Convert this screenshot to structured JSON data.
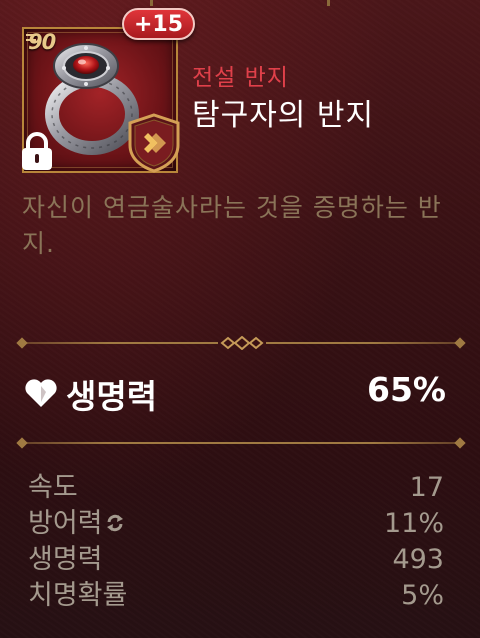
{
  "item": {
    "level": "90",
    "enhance": "+15",
    "grade": "전설 반지",
    "name": "탐구자의 반지",
    "description": "자신이 연금술사라는 것을 증명하는 반지.",
    "locked": true
  },
  "main_stat": {
    "icon": "heart-icon",
    "label": "생명력",
    "value": "65%"
  },
  "sub_stats": [
    {
      "label": "속도",
      "value": "17",
      "icon": null
    },
    {
      "label": "방어력",
      "value": "11%",
      "icon": "cycle-icon"
    },
    {
      "label": "생명력",
      "value": "493",
      "icon": null
    },
    {
      "label": "치명확률",
      "value": "5%",
      "icon": null
    }
  ],
  "colors": {
    "grade": "#e0404a",
    "description": "#8a7458",
    "divider": "#a07a42",
    "sub_text": "#a49a8e"
  }
}
